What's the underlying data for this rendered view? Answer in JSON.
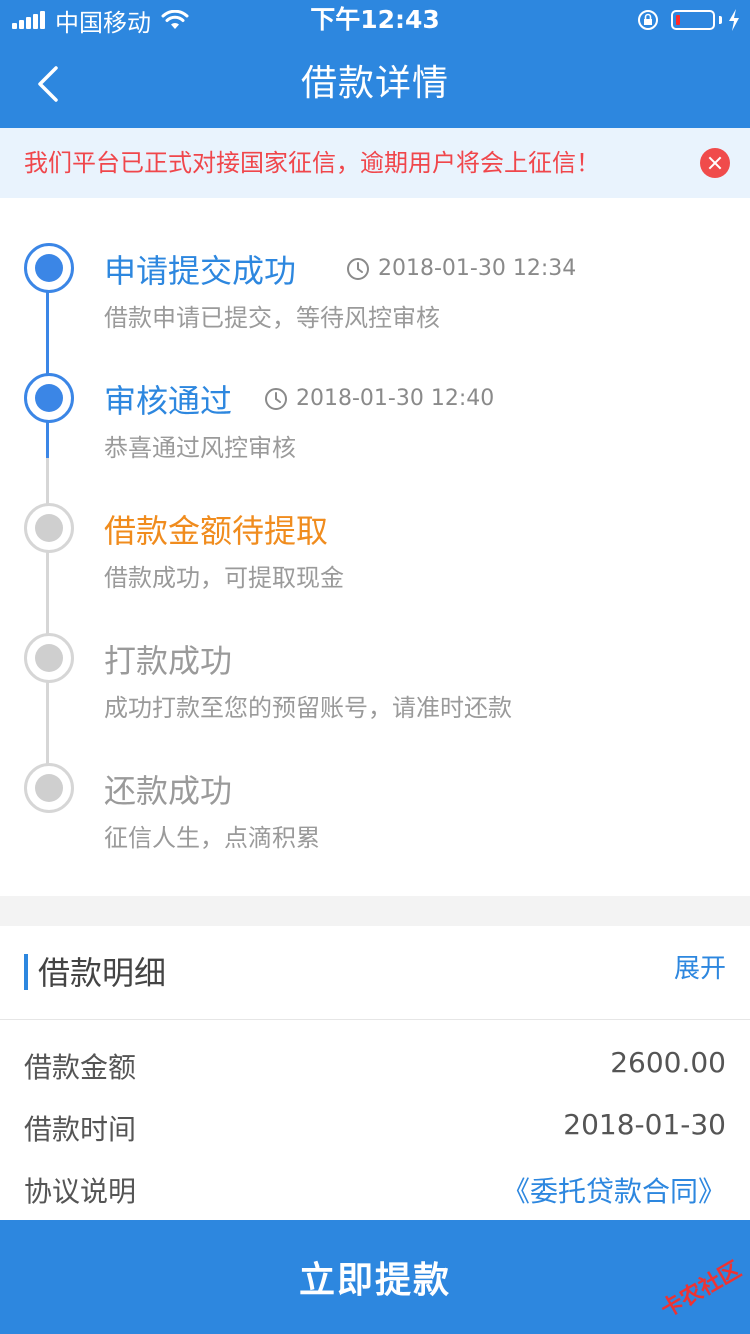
{
  "status_bar": {
    "carrier": "中国移动",
    "time": "下午12:43"
  },
  "nav": {
    "title": "借款详情"
  },
  "notice": {
    "text": "我们平台已正式对接国家征信，逾期用户将会上征信！"
  },
  "steps": [
    {
      "title": "申请提交成功",
      "time": "2018-01-30 12:34",
      "desc": "借款申请已提交，等待风控审核",
      "state": "done"
    },
    {
      "title": "审核通过",
      "time": "2018-01-30 12:40",
      "desc": "恭喜通过风控审核",
      "state": "done"
    },
    {
      "title": "借款金额待提取",
      "time": "",
      "desc": "借款成功，可提取现金",
      "state": "current"
    },
    {
      "title": "打款成功",
      "time": "",
      "desc": "成功打款至您的预留账号，请准时还款",
      "state": "pending"
    },
    {
      "title": "还款成功",
      "time": "",
      "desc": "征信人生，点滴积累",
      "state": "pending"
    }
  ],
  "details": {
    "title": "借款明细",
    "expand_label": "展开",
    "rows": [
      {
        "label": "借款金额",
        "value": "2600.00"
      },
      {
        "label": "借款时间",
        "value": "2018-01-30"
      },
      {
        "label": "协议说明",
        "value": "《委托贷款合同》"
      }
    ]
  },
  "submit": {
    "label": "立即提款"
  },
  "watermark": {
    "text": "卡农社区"
  },
  "colors": {
    "primary": "#2d87df",
    "done": "#3b86e6",
    "current": "#f08c1e",
    "pending": "#9a9a9a",
    "notice_text": "#f0464b"
  },
  "icons": {
    "back": "chevron-left-icon",
    "close": "close-circle-icon",
    "clock": "clock-icon"
  }
}
